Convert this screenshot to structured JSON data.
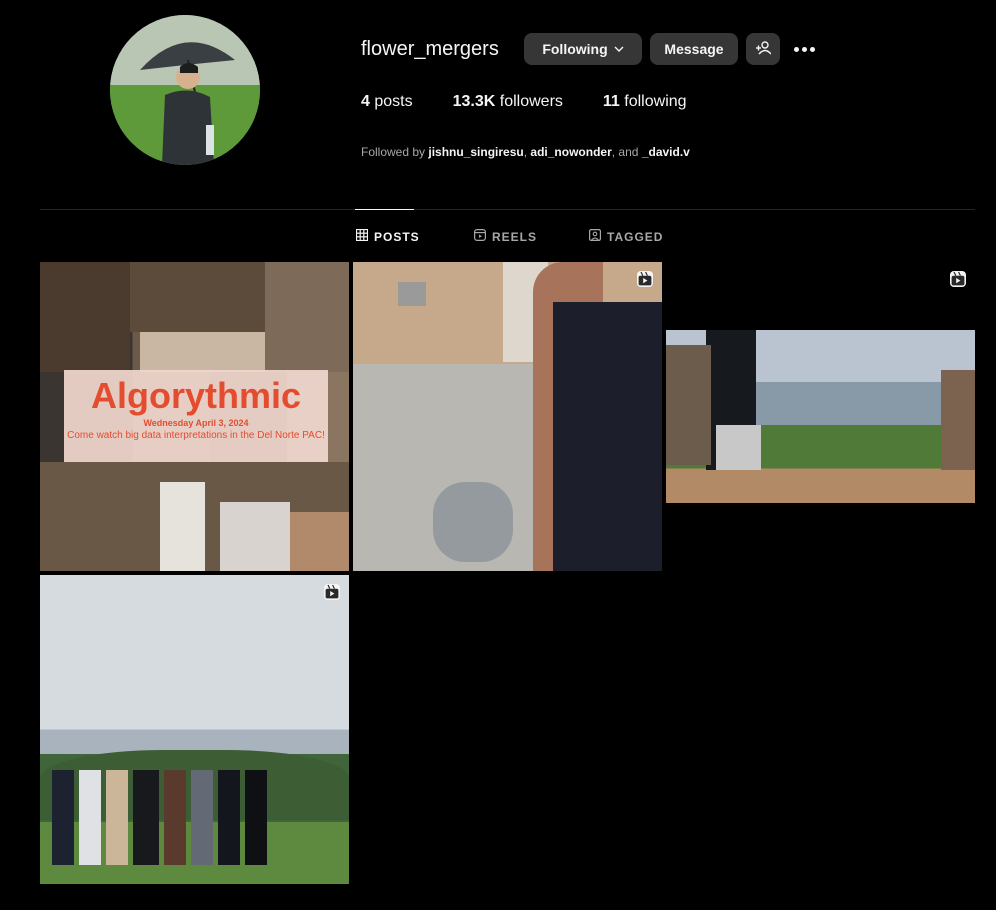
{
  "profile": {
    "username": "flower_mergers",
    "following_label": "Following",
    "message_label": "Message",
    "stats": {
      "posts_count": "4",
      "posts_label": "posts",
      "followers_count": "13.3K",
      "followers_label": "followers",
      "following_count": "11",
      "following_label": "following"
    },
    "followed_by": {
      "prefix": "Followed by",
      "users": [
        "jishnu_singiresu",
        "adi_nowonder",
        "_david.v"
      ],
      "sep1": ",",
      "and_text": ", and"
    }
  },
  "tabs": [
    {
      "label": "POSTS",
      "icon": "grid-icon",
      "active": true
    },
    {
      "label": "REELS",
      "icon": "reels-icon",
      "active": false
    },
    {
      "label": "TAGGED",
      "icon": "tagged-icon",
      "active": false
    }
  ],
  "posts": [
    {
      "type": "image",
      "banner_title": "Algorythmic",
      "banner_date": "Wednesday April 3, 2024",
      "banner_text": "Come watch big data interpretations in the Del Norte PAC!"
    },
    {
      "type": "reel",
      "icon": "reel-icon"
    },
    {
      "type": "reel",
      "icon": "reel-icon"
    },
    {
      "type": "reel",
      "icon": "reel-icon"
    }
  ],
  "colors": {
    "background": "#000000",
    "button_bg": "#363636",
    "text": "#f5f5f5",
    "muted": "#a8a8a8",
    "banner_red": "#e34c2f"
  }
}
